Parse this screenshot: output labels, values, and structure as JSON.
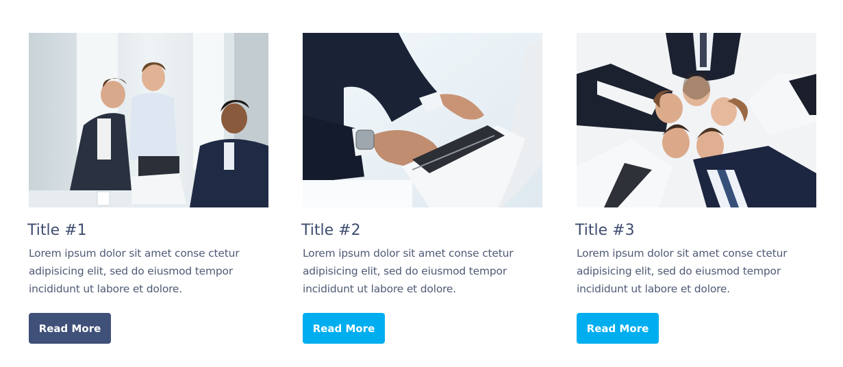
{
  "theme": {
    "title_color": "#3e4c6f",
    "text_color": "#4f5a75",
    "button_active_color": "#3f5079",
    "button_color": "#00aeef"
  },
  "cards": [
    {
      "image": "business-meeting-photo",
      "title": "Title #1",
      "description": "Lorem ipsum dolor sit amet conse ctetur adipisicing elit, sed do eiusmod tempor incididunt ut labore et dolore.",
      "button_label": "Read More",
      "button_color": "#3f5079"
    },
    {
      "image": "laptop-typing-photo",
      "title": "Title #2",
      "description": "Lorem ipsum dolor sit amet conse ctetur adipisicing elit, sed do eiusmod tempor incididunt ut labore et dolore.",
      "button_label": "Read More",
      "button_color": "#00aeef"
    },
    {
      "image": "team-circle-photo",
      "title": "Title #3",
      "description": "Lorem ipsum dolor sit amet conse ctetur adipisicing elit, sed do eiusmod tempor incididunt ut labore et dolore.",
      "button_label": "Read More",
      "button_color": "#00aeef"
    }
  ]
}
